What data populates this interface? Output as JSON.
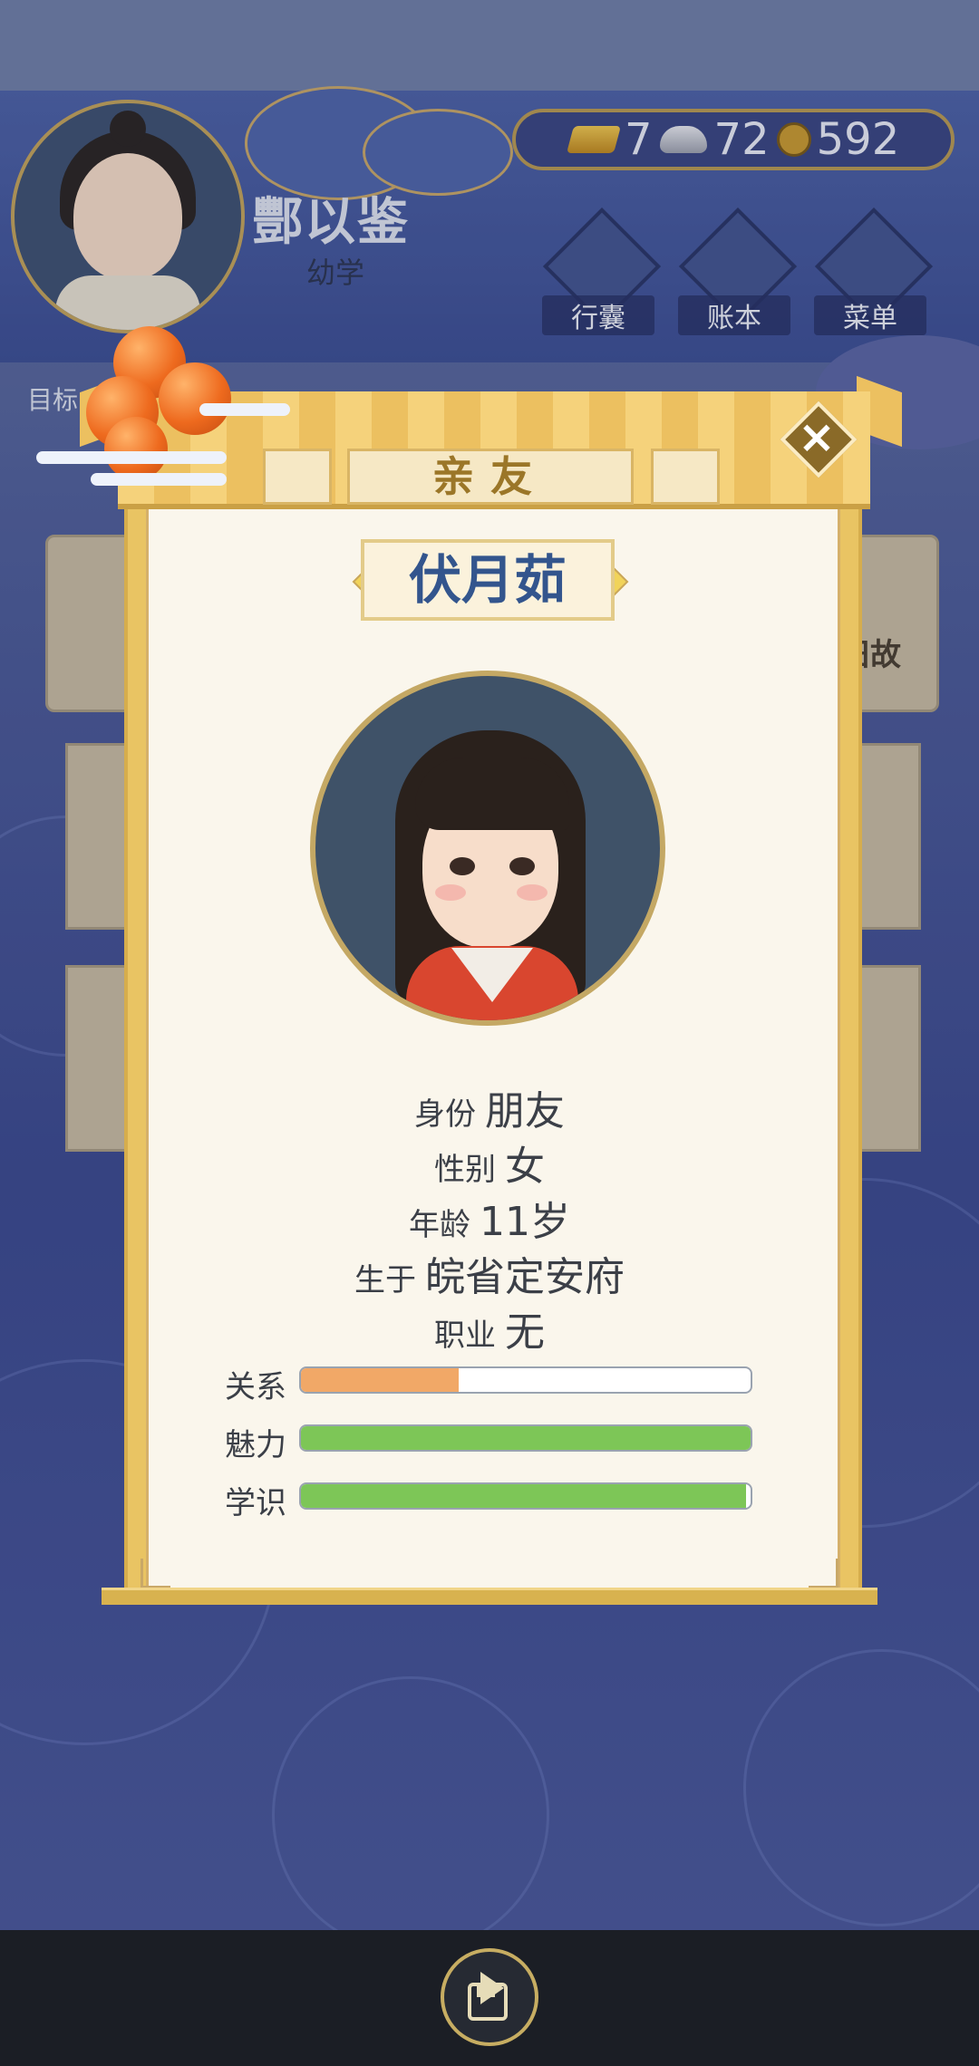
{
  "player": {
    "name": "酆以鉴",
    "title": "幼学"
  },
  "currency": {
    "gold": "7",
    "silver": "72",
    "coins": "592"
  },
  "menu": [
    {
      "label": "行囊",
      "icon": "bag-icon"
    },
    {
      "label": "账本",
      "icon": "ledger-icon"
    },
    {
      "label": "菜单",
      "icon": "more-icon"
    }
  ],
  "background": {
    "target_label": "目标",
    "side_text": "旧故"
  },
  "modal": {
    "title": "亲友",
    "character_name": "伏月茹",
    "info": [
      {
        "key": "身份",
        "value": "朋友"
      },
      {
        "key": "性别",
        "value": "女"
      },
      {
        "key": "年龄",
        "value": "11岁"
      },
      {
        "key": "生于",
        "value": "皖省定安府"
      },
      {
        "key": "职业",
        "value": "无"
      }
    ],
    "stats": [
      {
        "label": "关系",
        "fraction": 0.35,
        "color": "#f1a867"
      },
      {
        "label": "魅力",
        "fraction": 1.0,
        "color": "#7dc657"
      },
      {
        "label": "学识",
        "fraction": 0.99,
        "color": "#7dc657"
      }
    ]
  },
  "colors": {
    "accent_gold": "#c4a864",
    "name_blue": "#33558d",
    "panel_bg": "#faf6ec"
  }
}
